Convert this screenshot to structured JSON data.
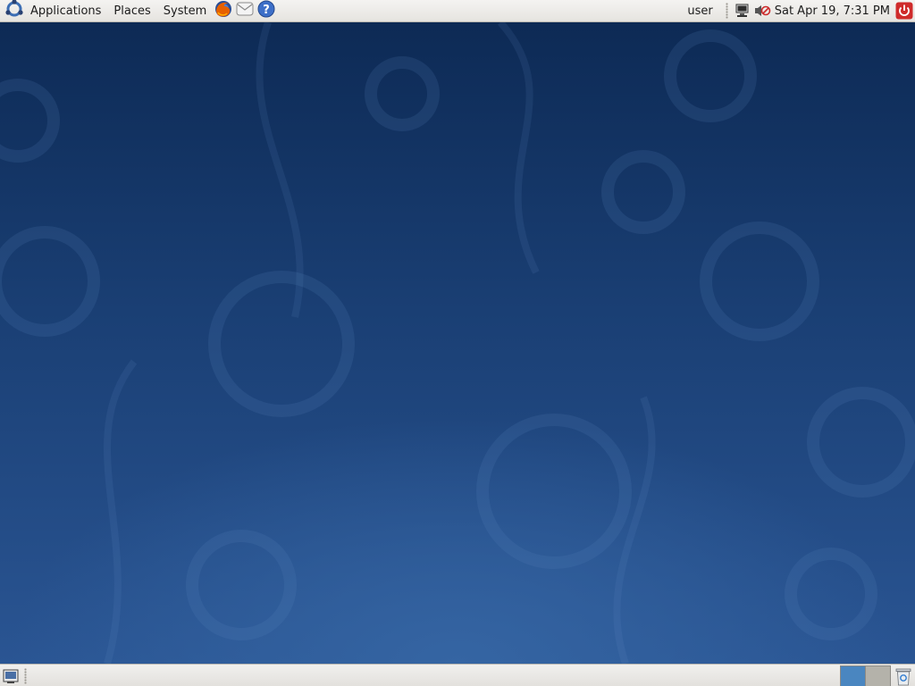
{
  "top_panel": {
    "menus": {
      "applications": "Applications",
      "places": "Places",
      "system": "System"
    },
    "launchers": [
      {
        "name": "firefox-icon"
      },
      {
        "name": "mail-icon"
      },
      {
        "name": "help-icon"
      }
    ],
    "user": "user",
    "clock": "Sat Apr 19,  7:31 PM"
  },
  "bottom_panel": {
    "workspaces": [
      {
        "label": "",
        "active": true
      },
      {
        "label": "",
        "active": false
      }
    ]
  },
  "colors": {
    "panel": "#e6e4e0",
    "desktop_top": "#0d2a55",
    "desktop_bottom": "#2a5593",
    "workspace_active": "#4a86c0",
    "workspace_inactive": "#b4b2aa"
  }
}
